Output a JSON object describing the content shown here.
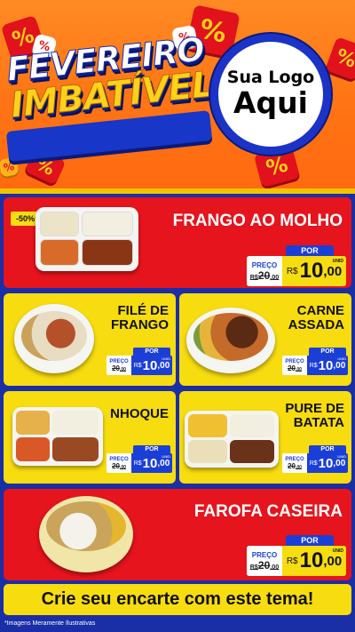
{
  "header": {
    "headline_line1": "FEVEREIRO",
    "headline_line2": "IMBATÍVEL",
    "logo_line1": "Sua Logo",
    "logo_line2": "Aqui",
    "percent_symbol": "%"
  },
  "products": [
    {
      "name": "FRANGO AO MOLHO",
      "badge": "-50%",
      "por": "POR",
      "preco_label": "PREÇO",
      "old_price": "20",
      "old_cents": ",00",
      "old_prefix": "R$",
      "currency": "R$",
      "price_int": "10",
      "price_dec": ",00",
      "unit": "UNID"
    },
    {
      "name_l1": "FILÉ DE",
      "name_l2": "FRANGO",
      "por": "POR",
      "preco_label": "PREÇO",
      "old_price": "20",
      "old_cents": ",00",
      "old_prefix": "R$",
      "currency": "R$",
      "price_int": "10",
      "price_dec": ",00",
      "unit": "UNID"
    },
    {
      "name_l1": "CARNE",
      "name_l2": "ASSADA",
      "por": "POR",
      "preco_label": "PREÇO",
      "old_price": "20",
      "old_cents": ",00",
      "old_prefix": "R$",
      "currency": "R$",
      "price_int": "10",
      "price_dec": ",00",
      "unit": "UNID"
    },
    {
      "name": "NHOQUE",
      "por": "POR",
      "preco_label": "PREÇO",
      "old_price": "20",
      "old_cents": ",00",
      "old_prefix": "R$",
      "currency": "R$",
      "price_int": "10",
      "price_dec": ",00",
      "unit": "UNID"
    },
    {
      "name_l1": "PURE DE",
      "name_l2": "BATATA",
      "por": "POR",
      "preco_label": "PREÇO",
      "old_price": "20",
      "old_cents": ",00",
      "old_prefix": "R$",
      "currency": "R$",
      "price_int": "10",
      "price_dec": ",00",
      "unit": "UNID"
    },
    {
      "name": "FAROFA CASEIRA",
      "por": "POR",
      "preco_label": "PREÇO",
      "old_price": "20",
      "old_cents": ",00",
      "old_prefix": "R$",
      "currency": "R$",
      "price_int": "10",
      "price_dec": ",00",
      "unit": "UNID"
    }
  ],
  "cta": "Crie seu encarte com este tema!",
  "footnote": "*Imagens Meramente Ilustrativas",
  "colors": {
    "red": "#e5141d",
    "yellow": "#f7dc10",
    "blue": "#1b3fd6",
    "orange": "#ff7414"
  }
}
